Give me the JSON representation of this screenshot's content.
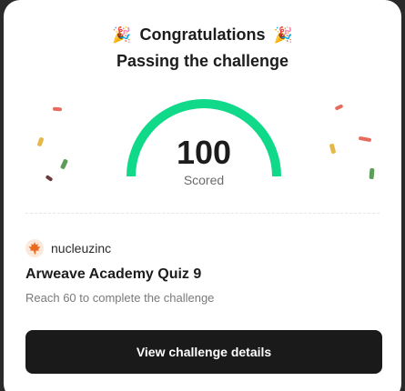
{
  "header": {
    "emoji_left": "🎉",
    "title": "Congratulations",
    "emoji_right": "🎉",
    "subtitle": "Passing the challenge"
  },
  "score": {
    "value": "100",
    "label": "Scored",
    "fraction": 1.0
  },
  "colors": {
    "gauge": "#10d98a",
    "button_bg": "#1a1a1a",
    "confetti": [
      "#e66b5c",
      "#e6b84a",
      "#5a9e5a",
      "#6b3a3a"
    ]
  },
  "org": {
    "name": "nucleuzinc",
    "avatar_icon": "maple-leaf-icon"
  },
  "quiz": {
    "title": "Arweave Academy Quiz 9",
    "description": "Reach 60 to complete the challenge"
  },
  "actions": {
    "view_details_label": "View challenge details"
  }
}
